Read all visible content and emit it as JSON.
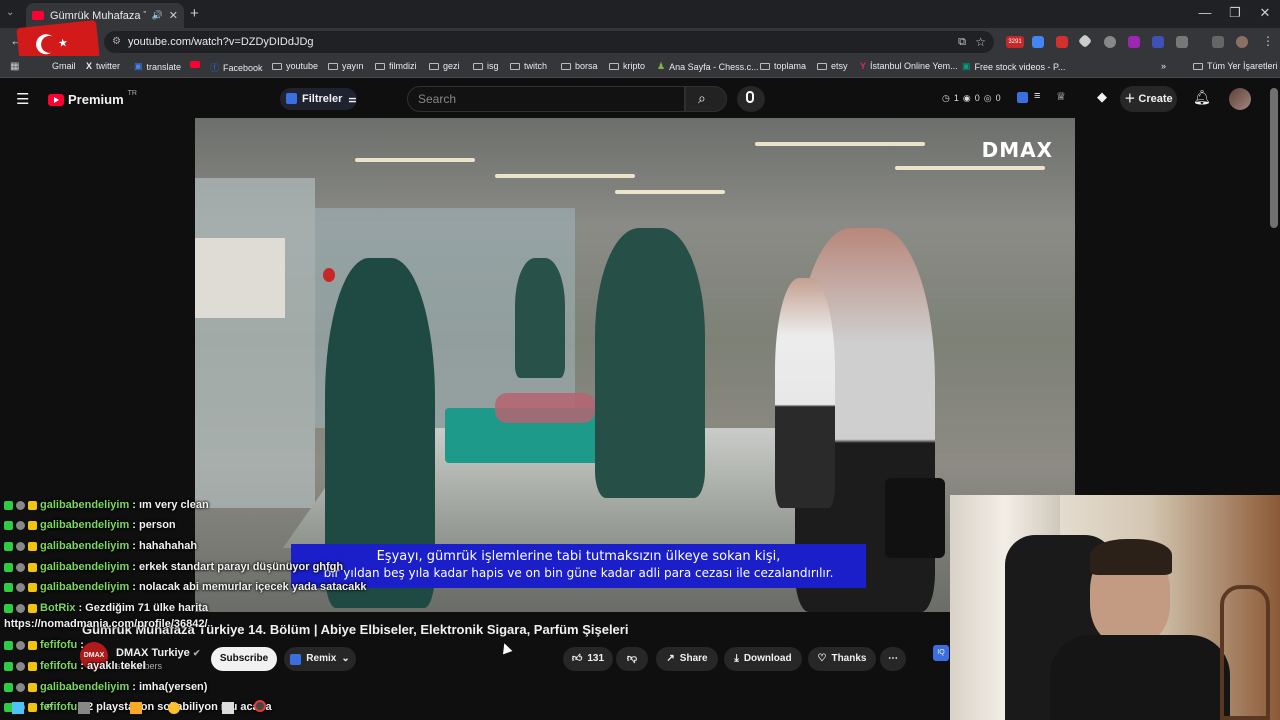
{
  "browser": {
    "tab_title": "Gümrük Muhafaza Türkiye",
    "url": "youtube.com/watch?v=DZDyDIDdJDg",
    "bookmarks": [
      "Gmail",
      "twitter",
      "translate",
      "Facebook",
      "youtube",
      "yayın",
      "filmdizi",
      "gezi",
      "isg",
      "twitch",
      "borsa",
      "kripto",
      "Ana Sayfa - Chess.c...",
      "toplama",
      "etsy",
      "İstanbul Online Yem...",
      "Free stock videos - P...",
      "Tüm Yer İşaretleri"
    ],
    "ext_badge": "3291"
  },
  "youtube": {
    "logo_text": "Premium",
    "logo_sup": "TR",
    "filter_label": "Filtreler",
    "search_placeholder": "Search",
    "counter_a": "1",
    "counter_b": "0",
    "counter_c": "0",
    "create_label": "Create"
  },
  "video": {
    "watermark": "DMAX",
    "subtitle_line1": "Eşyayı, gümrük işlemlerine tabi tutmaksızın ülkeye sokan kişi,",
    "subtitle_line2": "bir yıldan beş yıla kadar hapis ve on bin güne kadar adli para cezası ile cezalandırılır.",
    "title": "Gümrük Muhafaza Türkiye 14. Bölüm | Abiye Elbiseler, Elektronik Sigara, Parfüm Şişeleri",
    "channel": "DMAX Turkiye",
    "channel_subs": "subscribers",
    "avatar_text": "DMAX",
    "subscribe": "Subscribe",
    "remix": "Remix",
    "likes": "131",
    "share": "Share",
    "download": "Download",
    "thanks": "Thanks"
  },
  "chat": [
    {
      "user": "galibabendeliyim",
      "text": ": ım very clean"
    },
    {
      "user": "galibabendeliyim",
      "text": ": person"
    },
    {
      "user": "galibabendeliyim",
      "text": ": hahahahah"
    },
    {
      "user": "galibabendeliyim",
      "text": ": erkek standart parayı düşünüyor ghfgh"
    },
    {
      "user": "galibabendeliyim",
      "text": ": nolacak abi memurlar içecek yada satacakk"
    },
    {
      "user": "BotRix",
      "text": ": Gezdiğim 71 ülke harita"
    },
    {
      "user": "",
      "text": "https://nomadmania.com/profile/36842/"
    },
    {
      "user": "fefifofu",
      "text": ":"
    },
    {
      "user": "fefifofu",
      "text": ": ayaklı tekel"
    },
    {
      "user": "galibabendeliyim",
      "text": ": imha(yersen)"
    },
    {
      "user": "fefifofu",
      "text": ": 2 playstation sokabiliyon mu acaba"
    }
  ],
  "colors": {
    "chat_user": "#7bd85f",
    "subtitle_bg": "#1a1fc9",
    "youtube_red": "#ff0033"
  }
}
